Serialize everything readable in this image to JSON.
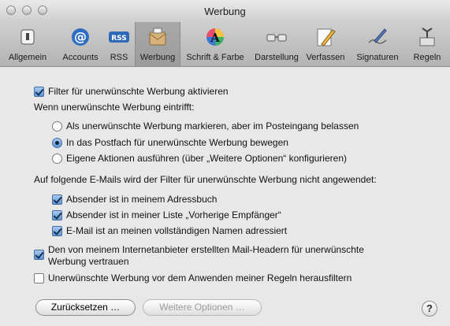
{
  "window": {
    "title": "Werbung"
  },
  "toolbar": {
    "items": [
      {
        "label": "Allgemein"
      },
      {
        "label": "Accounts"
      },
      {
        "label": "RSS"
      },
      {
        "label": "Werbung"
      },
      {
        "label": "Schrift & Farbe"
      },
      {
        "label": "Darstellung"
      },
      {
        "label": "Verfassen"
      },
      {
        "label": "Signaturen"
      },
      {
        "label": "Regeln"
      }
    ],
    "selected": "Werbung"
  },
  "content": {
    "enable_filter": {
      "label": "Filter für unerwünschte Werbung aktivieren",
      "checked": true
    },
    "when_heading": "Wenn unerwünschte Werbung eintrifft:",
    "radio_options": [
      {
        "label": "Als unerwünschte Werbung markieren, aber im Posteingang belassen",
        "checked": false
      },
      {
        "label": "In das Postfach für unerwünschte Werbung bewegen",
        "checked": true
      },
      {
        "label": "Eigene Aktionen ausführen (über „Weitere Optionen“ konfigurieren)",
        "checked": false
      }
    ],
    "exempt_heading": "Auf folgende E-Mails wird der Filter für unerwünschte Werbung nicht angewendet:",
    "exempt_options": [
      {
        "label": "Absender ist in meinem Adressbuch",
        "checked": true
      },
      {
        "label": "Absender ist in meiner Liste „Vorherige Empfänger“",
        "checked": true
      },
      {
        "label": "E-Mail ist an meinen vollständigen Namen adressiert",
        "checked": true
      }
    ],
    "trust_headers": {
      "label_line1": "Den von meinem Internetanbieter erstellten Mail-Headern für unerwünschte",
      "label_line2": "Werbung vertrauen",
      "checked": true
    },
    "prefilter": {
      "label": "Unerwünschte Werbung vor dem Anwenden meiner Regeln herausfiltern",
      "checked": false
    }
  },
  "buttons": {
    "reset": "Zurücksetzen …",
    "more_options": "Weitere Optionen …",
    "help": "?"
  }
}
